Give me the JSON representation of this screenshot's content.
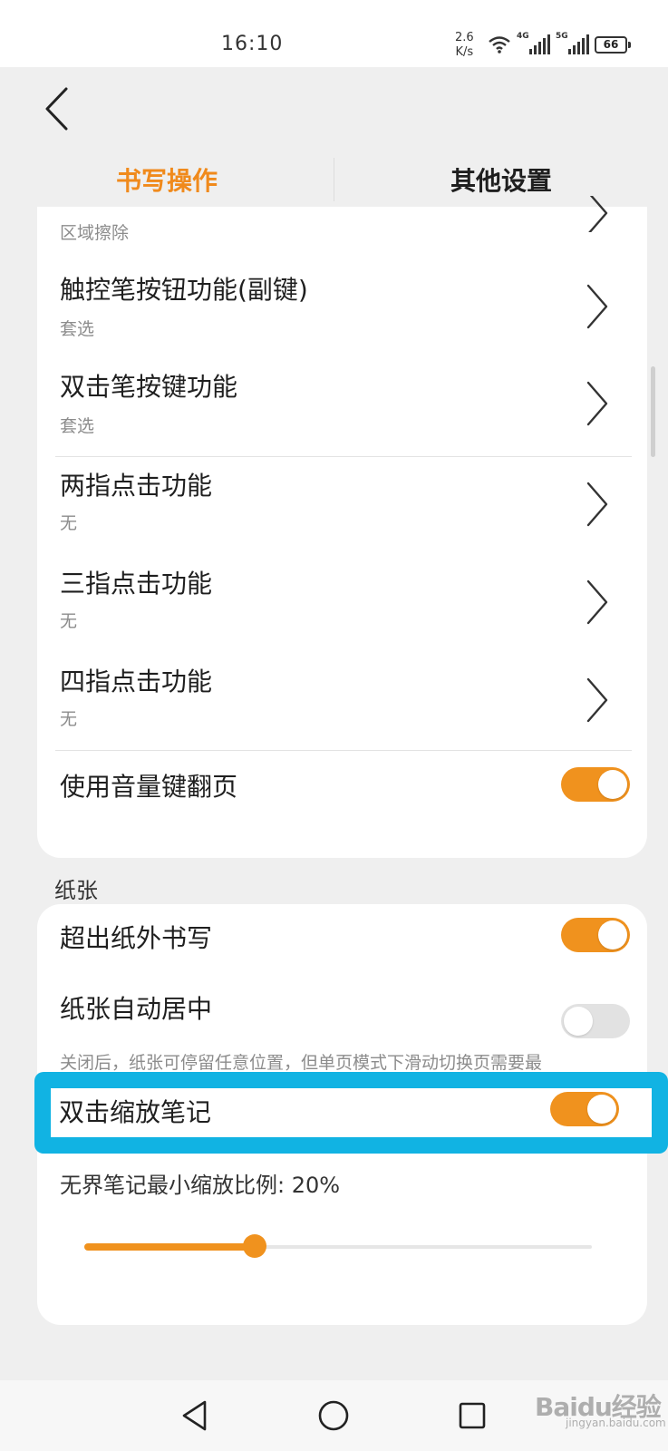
{
  "status_bar": {
    "time": "16:10",
    "net_speed_value": "2.6",
    "net_speed_unit": "K/s",
    "signal_1_tag": "4G",
    "signal_2_tag": "5G",
    "battery": "66",
    "icons": [
      "wifi-icon",
      "signal-4g-icon",
      "signal-5g-icon",
      "battery-icon"
    ]
  },
  "header": {
    "back_icon": "chevron-left-icon"
  },
  "tabs": [
    {
      "label": "书写操作",
      "active": true
    },
    {
      "label": "其他设置",
      "active": false
    }
  ],
  "writing_card": {
    "partial_item_sub": "区域擦除",
    "items": [
      {
        "title": "触控笔按钮功能(副键)",
        "value": "套选"
      },
      {
        "title": "双击笔按键功能",
        "value": "套选"
      },
      {
        "title": "两指点击功能",
        "value": "无"
      },
      {
        "title": "三指点击功能",
        "value": "无"
      },
      {
        "title": "四指点击功能",
        "value": "无"
      }
    ],
    "volume_page_turn": {
      "title": "使用音量键翻页",
      "on": true
    }
  },
  "paper_section": {
    "label": "纸张",
    "write_outside": {
      "title": "超出纸外书写",
      "on": true
    },
    "auto_center": {
      "title": "纸张自动居中",
      "on": false,
      "description": "关闭后，纸张可停留任意位置，但单页模式下滑动切换页需要最"
    },
    "double_tap_zoom": {
      "title": "双击缩放笔记",
      "on": true
    },
    "min_zoom": {
      "label": "无界笔记最小缩放比例: 20%",
      "value_percent": 20,
      "slider_fraction": 0.335
    }
  },
  "colors": {
    "accent": "#f0921e",
    "tab_active": "#f08a1c",
    "highlight": "#11b3e3"
  },
  "nav_bar": {
    "icons": [
      "back-triangle-icon",
      "home-circle-icon",
      "recents-square-icon"
    ]
  },
  "watermark": {
    "main": "Baidu经验",
    "sub": "jingyan.baidu.com"
  }
}
